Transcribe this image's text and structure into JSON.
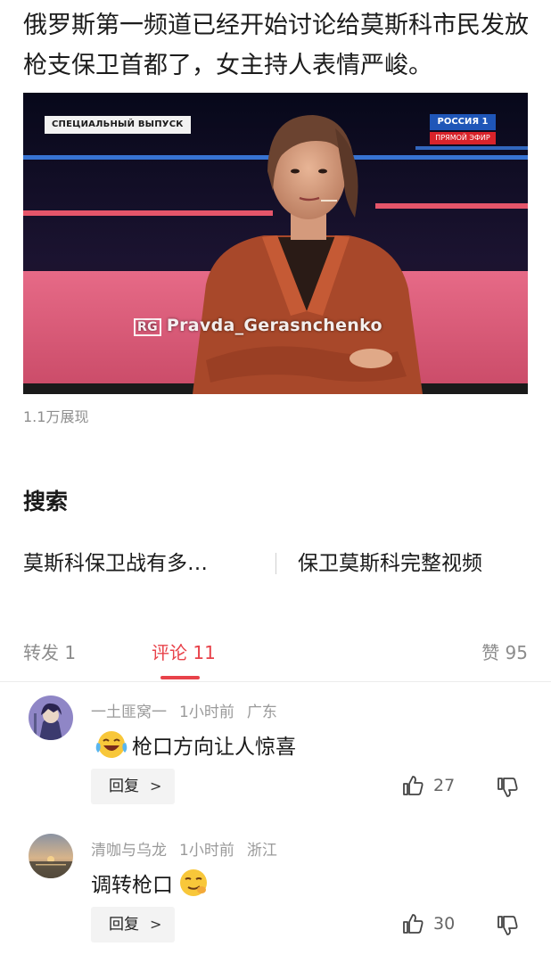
{
  "post": {
    "text": "俄罗斯第一频道已经开始讨论给莫斯科市民发放枪支保卫首都了，女主持人表情严峻。",
    "views": "1.1万展现"
  },
  "video": {
    "badge": "СПЕЦИАЛЬНЫЙ ВЫПУСК",
    "channel_name": "РОССИЯ 1",
    "channel_live": "ПРЯМОЙ ЭФИР",
    "watermark_mark": "RG",
    "watermark_text": "Pravda_Gerasnchenko"
  },
  "search": {
    "title": "搜索",
    "suggestions": [
      "莫斯科保卫战有多…",
      "保卫莫斯科完整视频"
    ]
  },
  "tabs": {
    "repost": "转发 1",
    "comments": "评论 11",
    "likes": "赞 95",
    "active_color": "#e8424a"
  },
  "comments": [
    {
      "user": "一土匪窝一",
      "time": "1小时前",
      "location": "广东",
      "emoji": "laughing-tears",
      "text": "枪口方向让人惊喜",
      "reply_label": "回复",
      "reply_chevron": ">",
      "likes": "27"
    },
    {
      "user": "清咖与乌龙",
      "time": "1小时前",
      "location": "浙江",
      "emoji": "smirk",
      "text": "调转枪口",
      "reply_label": "回复",
      "reply_chevron": ">",
      "likes": "30"
    }
  ]
}
